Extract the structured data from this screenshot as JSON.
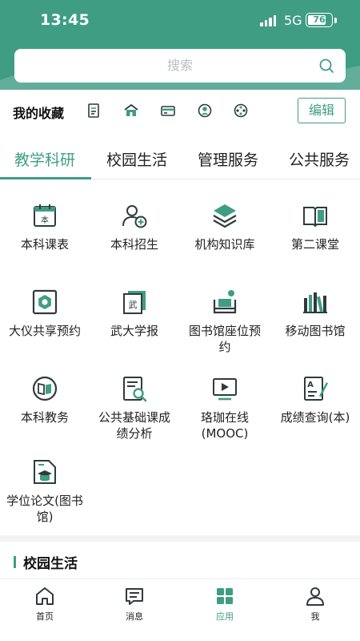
{
  "status_bar": {
    "time": "13:45",
    "network": "5G",
    "battery": "76"
  },
  "search": {
    "placeholder": "搜索"
  },
  "favorites": {
    "title": "我的收藏",
    "edit_label": "编辑",
    "icons": [
      "document-icon",
      "house-icon",
      "card-icon",
      "badge-icon",
      "film-reel-icon"
    ]
  },
  "tabs": [
    "教学科研",
    "校园生活",
    "管理服务",
    "公共服务"
  ],
  "apps": [
    {
      "label": "本科课表",
      "icon": "calendar-icon"
    },
    {
      "label": "本科招生",
      "icon": "add-person-icon"
    },
    {
      "label": "机构知识库",
      "icon": "layers-icon"
    },
    {
      "label": "第二课堂",
      "icon": "open-book-icon"
    },
    {
      "label": "大仪共享预约",
      "icon": "hex-nut-icon"
    },
    {
      "label": "武大学报",
      "icon": "journal-icon"
    },
    {
      "label": "图书馆座位预约",
      "icon": "sofa-icon"
    },
    {
      "label": "移动图书馆",
      "icon": "bookshelf-icon"
    },
    {
      "label": "本科教务",
      "icon": "book-circle-icon"
    },
    {
      "label": "公共基础课成绩分析",
      "icon": "report-search-icon"
    },
    {
      "label": "珞珈在线(MOOC)",
      "icon": "video-play-icon"
    },
    {
      "label": "成绩查询(本)",
      "icon": "grade-pen-icon"
    },
    {
      "label": "学位论文(图书馆)",
      "icon": "graduate-doc-icon"
    }
  ],
  "section": {
    "title": "校园生活"
  },
  "tabbar": [
    {
      "label": "首页",
      "icon": "home-icon"
    },
    {
      "label": "消息",
      "icon": "message-icon"
    },
    {
      "label": "应用",
      "icon": "apps-grid-icon"
    },
    {
      "label": "我",
      "icon": "user-icon"
    }
  ],
  "colors": {
    "brand": "#3f9d84",
    "dark": "#2f3b3b"
  }
}
